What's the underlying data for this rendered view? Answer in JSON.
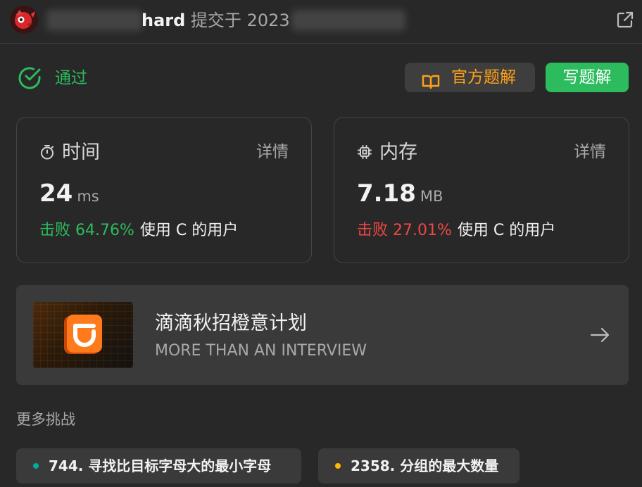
{
  "header": {
    "problem_suffix": "hard",
    "submitted_text": "提交于 2023"
  },
  "status": {
    "label": "通过",
    "color": "#2cbb5d"
  },
  "buttons": {
    "official_solution": "官方题解",
    "write_solution": "写题解"
  },
  "time_card": {
    "title": "时间",
    "detail": "详情",
    "value": "24",
    "unit": "ms",
    "beats": "击败 64.76%",
    "suffix": "使用 C 的用户",
    "icon": "stopwatch-icon"
  },
  "memory_card": {
    "title": "内存",
    "detail": "详情",
    "value": "7.18",
    "unit": "MB",
    "beats": "击败 27.01%",
    "suffix": "使用 C 的用户",
    "icon": "chip-icon"
  },
  "banner": {
    "title": "滴滴秋招橙意计划",
    "subtitle": "MORE THAN AN INTERVIEW"
  },
  "more_challenges": {
    "label": "更多挑战",
    "items": [
      {
        "text": "744. 寻找比目标字母大的最小字母",
        "dot_color": "#00af9b"
      },
      {
        "text": "2358. 分组的最大数量",
        "dot_color": "#ffb800"
      }
    ]
  },
  "colors": {
    "accent_orange": "#ffa116",
    "success_green": "#2cbb5d",
    "danger_red": "#ef4743"
  }
}
